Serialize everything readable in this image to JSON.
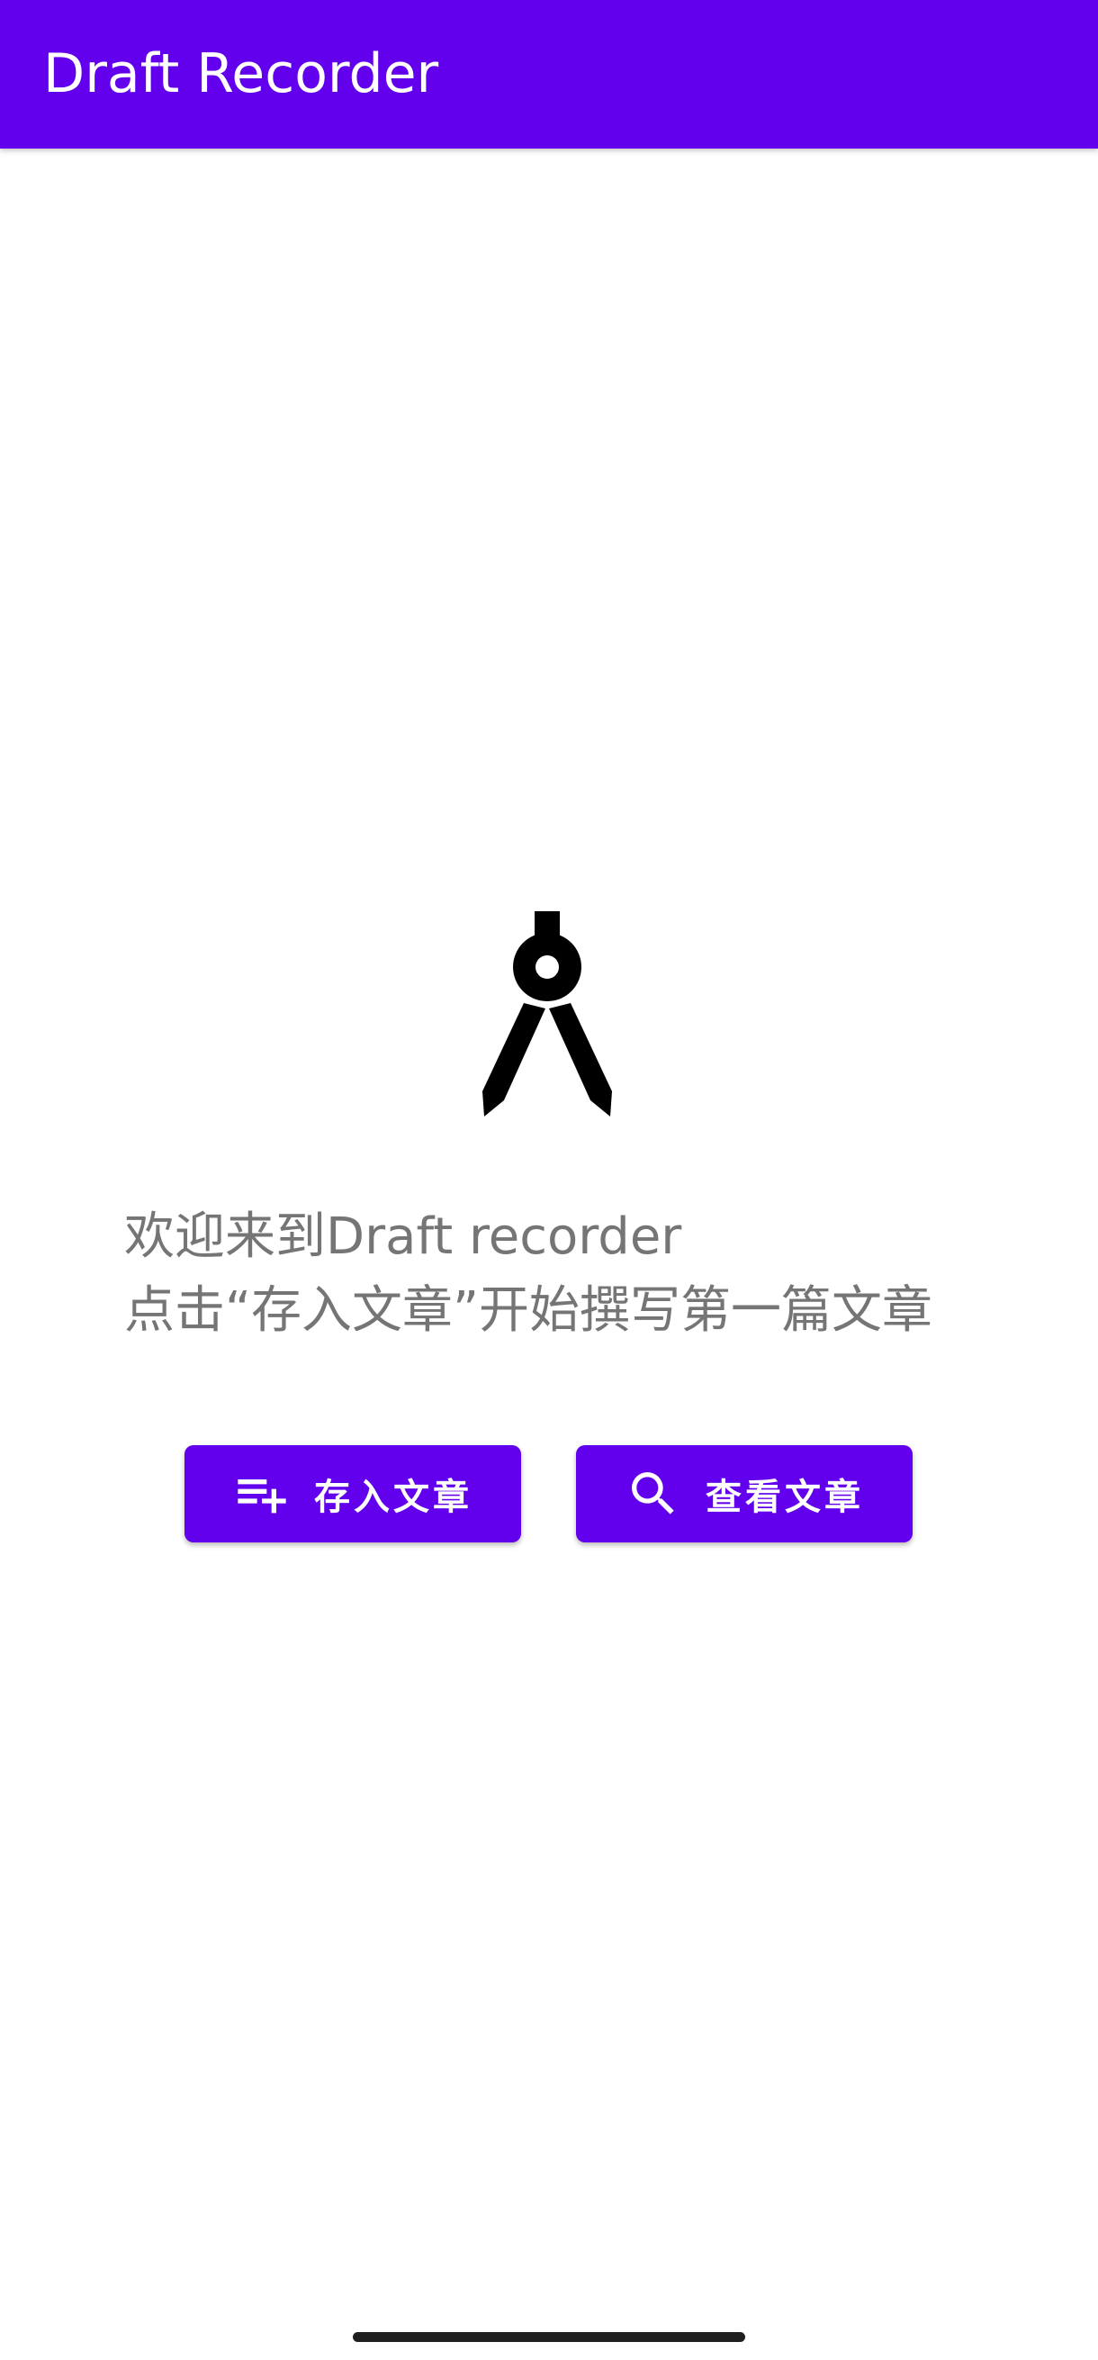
{
  "app_bar": {
    "title": "Draft Recorder",
    "color": "#6200EE"
  },
  "empty_state": {
    "icon": "drafting-compass-icon",
    "line1": "欢迎来到Draft recorder",
    "line2": "点击“存入文章”开始撰写第一篇文章"
  },
  "actions": {
    "save": {
      "label": "存入文章",
      "icon": "playlist-add-icon"
    },
    "view": {
      "label": "查看文章",
      "icon": "search-icon"
    }
  }
}
